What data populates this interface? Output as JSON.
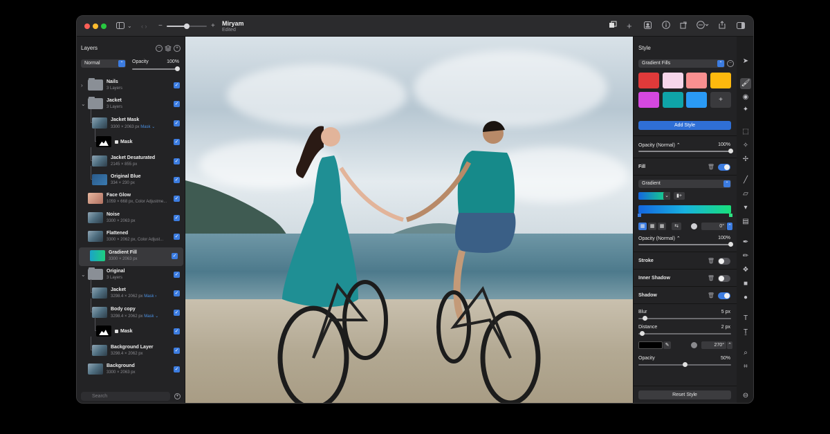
{
  "window": {
    "doc_title": "Miryam",
    "doc_status": "Edited",
    "zoom_fraction": 0.5
  },
  "titlebar_icons": {
    "sidebar": "sidebar-toggle-icon",
    "chevron": "chevron-down-icon",
    "nav": "back-forward-icon",
    "zoom_out": "−",
    "zoom_in": "+"
  },
  "layers_panel": {
    "title": "Layers",
    "blend_mode": "Normal",
    "opacity_label": "Opacity",
    "opacity_value": "100%",
    "search_placeholder": "Search",
    "layers": [
      {
        "name": "Nails",
        "meta": "3 Layers",
        "tag": "",
        "thumb": "folder",
        "indent": 0,
        "disclosure": "›",
        "selected": false
      },
      {
        "name": "Jacket",
        "meta": "3 Layers",
        "tag": "",
        "thumb": "folder",
        "indent": 0,
        "disclosure": "⌄",
        "selected": false
      },
      {
        "name": "Jacket Mask",
        "meta": "3300 × 2063 px",
        "tag": "Mask ⌄",
        "thumb": "photo",
        "indent": 1,
        "disclosure": "",
        "selected": false
      },
      {
        "name": "Mask",
        "meta": "",
        "tag": "",
        "thumb": "mask",
        "indent": 2,
        "disclosure": "",
        "selected": false
      },
      {
        "name": "Jacket Desaturated",
        "meta": "2145 × 855 px",
        "tag": "",
        "thumb": "photo",
        "indent": 1,
        "disclosure": "",
        "selected": false
      },
      {
        "name": "Original Blue",
        "meta": "334 × 230 px",
        "tag": "",
        "thumb": "blue",
        "indent": 1,
        "disclosure": "",
        "selected": false
      },
      {
        "name": "Face Glow",
        "meta": "1059 × 668 px, Color Adjustme...",
        "tag": "",
        "thumb": "glow",
        "indent": 0,
        "disclosure": "",
        "selected": false
      },
      {
        "name": "Noise",
        "meta": "3300 × 2063 px",
        "tag": "",
        "thumb": "photo",
        "indent": 0,
        "disclosure": "",
        "selected": false
      },
      {
        "name": "Flattened",
        "meta": "3300 × 2062 px, Color Adjust...",
        "tag": "",
        "thumb": "photo",
        "indent": 0,
        "disclosure": "",
        "selected": false
      },
      {
        "name": "Gradient Fill",
        "meta": "3300 × 2063 px",
        "tag": "",
        "thumb": "gradient",
        "indent": 0,
        "disclosure": "",
        "selected": true
      },
      {
        "name": "Original",
        "meta": "3 Layers",
        "tag": "",
        "thumb": "folder",
        "indent": 0,
        "disclosure": "⌄",
        "selected": false
      },
      {
        "name": "Jacket",
        "meta": "3298.4 × 2062 px",
        "tag": "Mask ›",
        "thumb": "photo",
        "indent": 1,
        "disclosure": "",
        "selected": false
      },
      {
        "name": "Body copy",
        "meta": "3298.4 × 2062 px",
        "tag": "Mask ⌄",
        "thumb": "photo",
        "indent": 1,
        "disclosure": "",
        "selected": false
      },
      {
        "name": "Mask",
        "meta": "",
        "tag": "",
        "thumb": "mask",
        "indent": 2,
        "disclosure": "",
        "selected": false
      },
      {
        "name": "Background Layer",
        "meta": "3298.4 × 2062 px",
        "tag": "",
        "thumb": "photo",
        "indent": 1,
        "disclosure": "",
        "selected": false
      },
      {
        "name": "Background",
        "meta": "3300 × 2063 px",
        "tag": "",
        "thumb": "photo",
        "indent": 0,
        "disclosure": "",
        "selected": false
      }
    ]
  },
  "style_panel": {
    "title": "Style",
    "preset_group": "Gradient Fills",
    "swatches": [
      {
        "color": "#e03a3a"
      },
      {
        "color": "#f6d6ea"
      },
      {
        "color": "#f99090"
      },
      {
        "color": "#fdb90e"
      },
      {
        "color": "#d548e0"
      },
      {
        "color": "#0fa4a8"
      },
      {
        "color": "#2a9af5"
      }
    ],
    "add_swatch_label": "+",
    "add_style_label": "Add Style",
    "opacity_label": "Opacity (Normal) ⌃",
    "opacity_value": "100%",
    "fill_label": "Fill",
    "fill_type": "Gradient",
    "gradient_angle": "0°",
    "fill_opacity_label": "Opacity (Normal) ⌃",
    "fill_opacity_value": "100%",
    "stroke_label": "Stroke",
    "inner_shadow_label": "Inner Shadow",
    "shadow_label": "Shadow",
    "blur_label": "Blur",
    "blur_value": "5 px",
    "distance_label": "Distance",
    "distance_value": "2 px",
    "shadow_angle": "270°",
    "shadow_opacity_label": "Opacity",
    "shadow_opacity_value": "50%",
    "shadow_opacity_fraction": 0.5,
    "reset_label": "Reset Style",
    "toggles": {
      "fill": true,
      "stroke": false,
      "inner_shadow": false,
      "shadow": true
    }
  },
  "colors": {
    "accent": "#3c7ce0",
    "panel_bg": "#232325",
    "selected_row": "#39393c"
  }
}
